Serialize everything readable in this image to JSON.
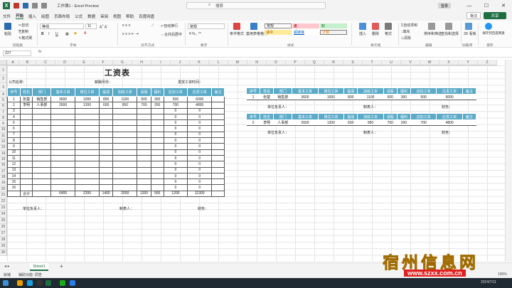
{
  "window": {
    "title": "工作簿1 - Excel Preview",
    "search_placeholder": "搜索",
    "user": "登录",
    "share": "共享",
    "comment": "批注"
  },
  "menu": [
    "文件",
    "开始",
    "插入",
    "绘图",
    "页面布局",
    "公式",
    "数据",
    "审阅",
    "视图",
    "帮助",
    "百度网盘"
  ],
  "ribbon": {
    "clipboard": {
      "paste": "粘贴",
      "cut": "剪切",
      "copy": "复制",
      "format_painter": "格式刷",
      "group": "剪贴板"
    },
    "font": {
      "name": "等线",
      "size": "11",
      "group": "字体"
    },
    "alignment": {
      "wrap": "自动换行",
      "merge": "合并后居中",
      "group": "对齐方式"
    },
    "number": {
      "format": "常规",
      "group": "数字"
    },
    "styles": {
      "cond": "条件格式",
      "table": "套用表格格式",
      "normal": "常规",
      "bad": "差",
      "good": "好",
      "neutral": "适中",
      "calc": "计算",
      "hyperlink": "超链接",
      "group": "样式"
    },
    "cells": {
      "insert": "插入",
      "delete": "删除",
      "format": "格式",
      "group": "单元格"
    },
    "editing": {
      "autosum": "自动求和",
      "fill": "填充",
      "clear": "清除",
      "sort": "排序和筛选",
      "find": "查找和选择",
      "group": "编辑"
    },
    "addins": {
      "label": "加载项",
      "d3": "3D 看板",
      "group": "加载项"
    },
    "save": {
      "label": "保存到百度网盘",
      "group": "保存"
    }
  },
  "formula_bar": {
    "name_box": "Z27",
    "fx": "fx"
  },
  "columns": [
    "A",
    "B",
    "C",
    "D",
    "E",
    "F",
    "G",
    "H",
    "I",
    "J",
    "K",
    "L",
    "M",
    "N",
    "O",
    "P",
    "Q",
    "R",
    "S",
    "T",
    "U",
    "V",
    "W",
    "X",
    "Y",
    "Z",
    "AA"
  ],
  "rows": [
    "1",
    "2",
    "3",
    "4",
    "5",
    "6",
    "7",
    "8",
    "9",
    "10",
    "11",
    "12",
    "13",
    "14",
    "15",
    "16",
    "17",
    "18",
    "19",
    "20",
    "21",
    "22",
    "23",
    "24",
    "25",
    "26",
    "27",
    "28",
    "29",
    "30"
  ],
  "sheet": {
    "title": "工资表",
    "company_label": "公司名称：",
    "month_label": "薪酬月份：",
    "paydate_label": "发放工资时间：",
    "headers": [
      "序号",
      "姓名",
      "部门",
      "基本工资",
      "岗位工资",
      "提成",
      "加班工资",
      "请假",
      "福利",
      "应扣工资",
      "应发工资",
      "备注"
    ],
    "rows": [
      [
        "1",
        "张楚",
        "销售部",
        "3600",
        "1000",
        "800",
        "1100",
        "500",
        "300",
        "500",
        "6000",
        ""
      ],
      [
        "2",
        "李明",
        "人事部",
        "2600",
        "1200",
        "600",
        "950",
        "700",
        "200",
        "700",
        "4800",
        ""
      ],
      [
        "3",
        "",
        "",
        "",
        "",
        "",
        "",
        "",
        "",
        "0",
        "0",
        ""
      ],
      [
        "4",
        "",
        "",
        "",
        "",
        "",
        "",
        "",
        "",
        "0",
        "0",
        ""
      ],
      [
        "5",
        "",
        "",
        "",
        "",
        "",
        "",
        "",
        "",
        "0",
        "0",
        ""
      ],
      [
        "6",
        "",
        "",
        "",
        "",
        "",
        "",
        "",
        "",
        "0",
        "0",
        ""
      ],
      [
        "7",
        "",
        "",
        "",
        "",
        "",
        "",
        "",
        "",
        "0",
        "0",
        ""
      ],
      [
        "8",
        "",
        "",
        "",
        "",
        "",
        "",
        "",
        "",
        "0",
        "0",
        ""
      ],
      [
        "9",
        "",
        "",
        "",
        "",
        "",
        "",
        "",
        "",
        "0",
        "0",
        ""
      ],
      [
        "10",
        "",
        "",
        "",
        "",
        "",
        "",
        "",
        "",
        "0",
        "0",
        ""
      ],
      [
        "11",
        "",
        "",
        "",
        "",
        "",
        "",
        "",
        "",
        "0",
        "0",
        ""
      ],
      [
        "12",
        "",
        "",
        "",
        "",
        "",
        "",
        "",
        "",
        "0",
        "0",
        ""
      ],
      [
        "13",
        "",
        "",
        "",
        "",
        "",
        "",
        "",
        "",
        "0",
        "0",
        ""
      ],
      [
        "14",
        "",
        "",
        "",
        "",
        "",
        "",
        "",
        "",
        "0",
        "0",
        ""
      ],
      [
        "15",
        "",
        "",
        "",
        "",
        "",
        "",
        "",
        "",
        "0",
        "0",
        ""
      ],
      [
        "16",
        "",
        "",
        "",
        "",
        "",
        "",
        "",
        "",
        "0",
        "0",
        ""
      ]
    ],
    "total": [
      "",
      "合计",
      "",
      "6400",
      "2200",
      "1400",
      "2050",
      "1200",
      "500",
      "1200",
      "11300",
      ""
    ],
    "footer": {
      "unit_head": "单位负责人：",
      "maker": "制表人：",
      "finance": "财务："
    }
  },
  "slips": {
    "headers": [
      "序号",
      "姓名",
      "部门",
      "基本工资",
      "岗位工资",
      "提成",
      "加班工资",
      "请假",
      "福利",
      "应扣工资",
      "应发工资",
      "备注"
    ],
    "rows": [
      [
        "1",
        "张楚",
        "销售部",
        "3600",
        "1000",
        "800",
        "1100",
        "500",
        "300",
        "500",
        "6000",
        ""
      ],
      [
        "2",
        "李明",
        "人事部",
        "2600",
        "1200",
        "600",
        "950",
        "700",
        "200",
        "700",
        "4800",
        ""
      ]
    ],
    "footer": {
      "unit_head": "单位负责人：",
      "maker": "制表人：",
      "finance": "财务："
    }
  },
  "tabs": {
    "sheet1": "Sheet1",
    "add": "+"
  },
  "status": {
    "ready": "就绪",
    "accessibility": "辅助功能: 调查",
    "zoom": "100%",
    "time": "2024/7/11"
  },
  "watermark": {
    "text": "宿州信息网",
    "url": "www.szxx.com.cn"
  }
}
